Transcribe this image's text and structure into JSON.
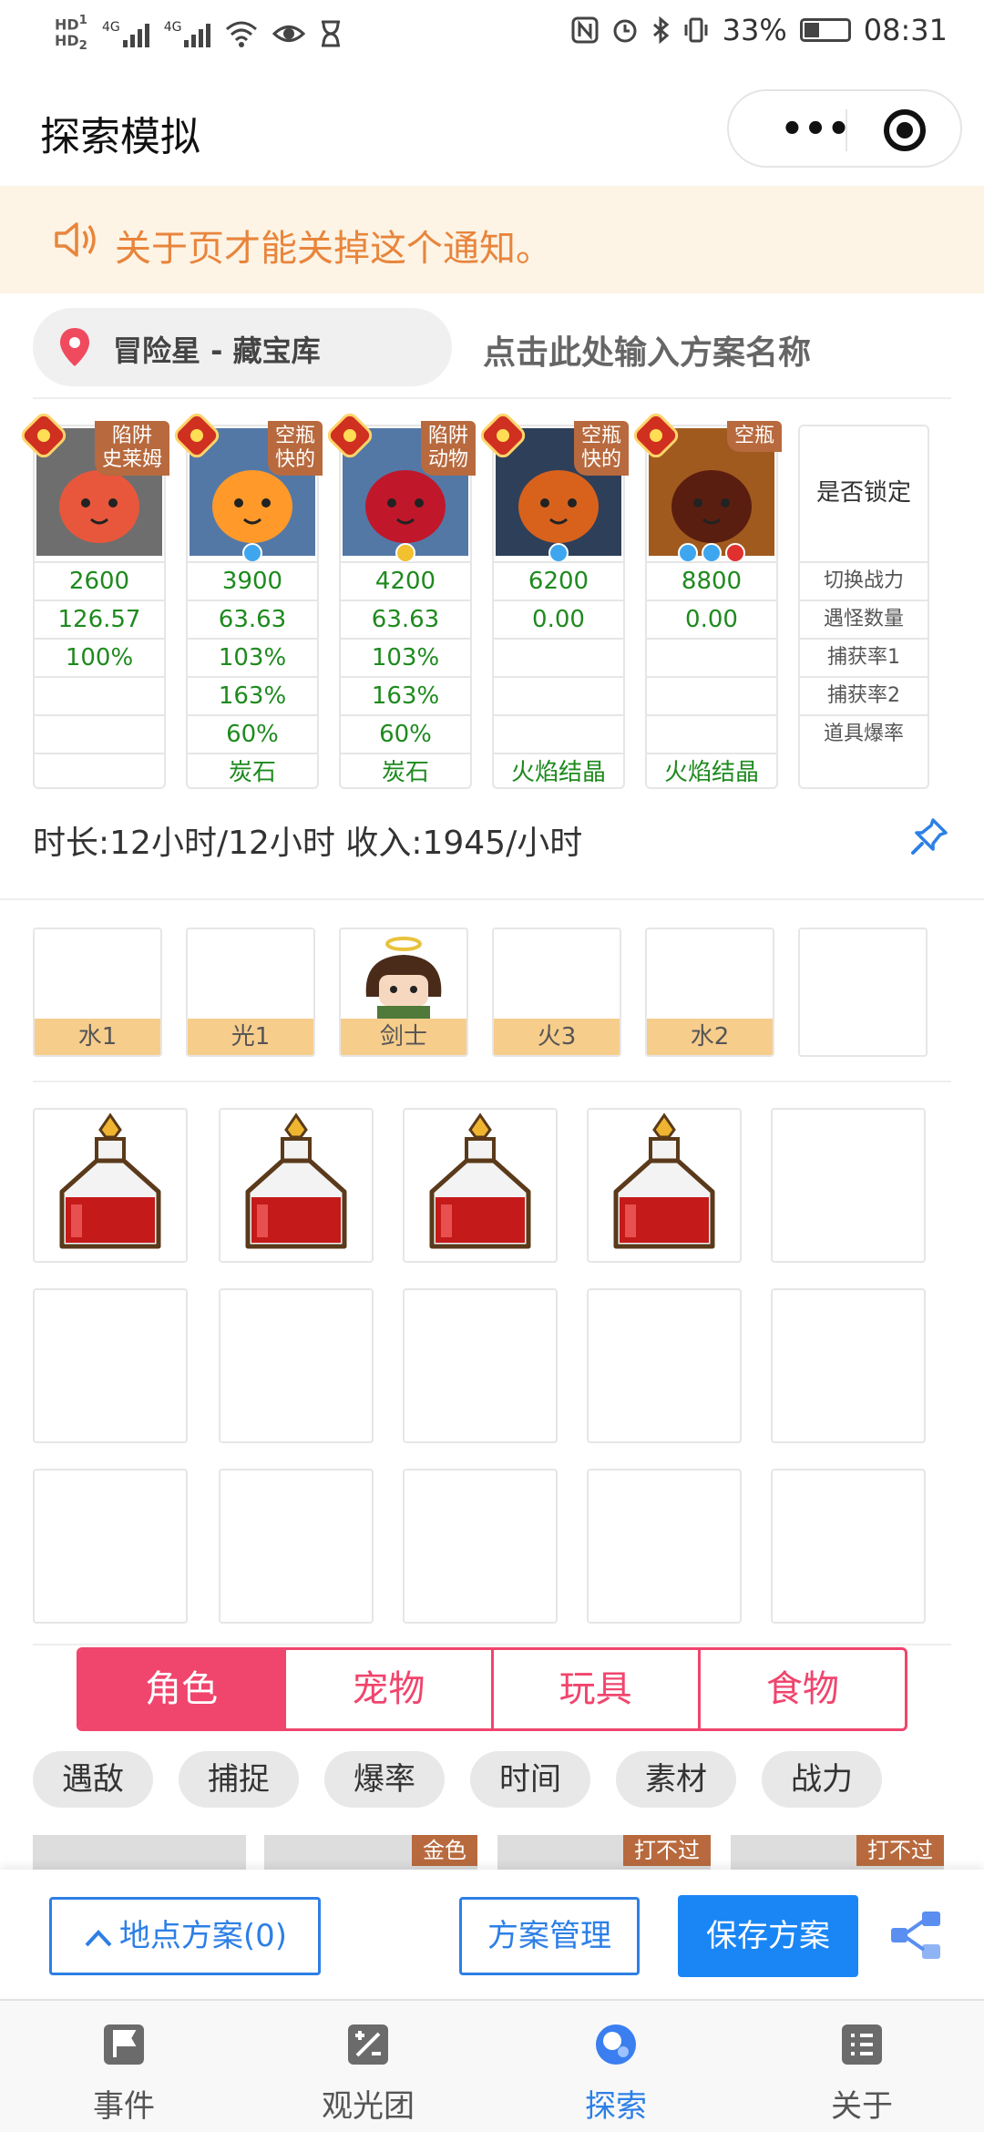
{
  "status_bar": {
    "network_left": "HD 1 / HD 2",
    "signal1": "4G",
    "signal2": "4G",
    "battery_percent": "33%",
    "time": "08:31"
  },
  "nav": {
    "title": "探索模拟",
    "menu_icon": "more-dots-icon",
    "close_icon": "target-icon"
  },
  "notice": {
    "text": "关于页才能关掉这个通知。"
  },
  "location": {
    "label": "冒险星 - 藏宝库",
    "plan_placeholder": "点击此处输入方案名称"
  },
  "monsters": [
    {
      "tag": "陷阱 史莱姆",
      "power": "2600",
      "encounters": "126.57",
      "cap1": "100%",
      "cap2": "",
      "drop": "",
      "item": "",
      "body": "#e8573c",
      "bg": "#6e6e6e"
    },
    {
      "tag": "空瓶 快的",
      "power": "3900",
      "encounters": "63.63",
      "cap1": "103%",
      "cap2": "163%",
      "drop": "60%",
      "item": "炭石",
      "body": "#ff9a2a",
      "bg": "#5478a6"
    },
    {
      "tag": "陷阱 动物",
      "power": "4200",
      "encounters": "63.63",
      "cap1": "103%",
      "cap2": "163%",
      "drop": "60%",
      "item": "炭石",
      "body": "#c0182a",
      "bg": "#5478a6"
    },
    {
      "tag": "空瓶 快的",
      "power": "6200",
      "encounters": "0.00",
      "cap1": "",
      "cap2": "",
      "drop": "",
      "item": "火焰结晶",
      "body": "#d8621c",
      "bg": "#2e3f59"
    },
    {
      "tag": "空瓶",
      "power": "8800",
      "encounters": "0.00",
      "cap1": "",
      "cap2": "",
      "drop": "",
      "item": "火焰结晶",
      "body": "#5a1e10",
      "bg": "#a05a1e"
    }
  ],
  "lock_column": {
    "header": "是否锁定",
    "rows": [
      "切换战力",
      "遇怪数量",
      "捕获率1",
      "捕获率2",
      "道具爆率"
    ]
  },
  "summary": {
    "text": "时长:12小时/12小时 收入:1945/小时"
  },
  "team": [
    {
      "label": "水1"
    },
    {
      "label": "光1"
    },
    {
      "label": "剑士"
    },
    {
      "label": "火3"
    },
    {
      "label": "水2"
    },
    {
      "label": ""
    }
  ],
  "tabs": [
    "角色",
    "宠物",
    "玩具",
    "食物"
  ],
  "active_tab": "角色",
  "filters": [
    "遇敌",
    "捕捉",
    "爆率",
    "时间",
    "素材",
    "战力"
  ],
  "card_badges": [
    "",
    "金色",
    "打不过",
    "打不过"
  ],
  "actions": {
    "location_plans": "地点方案(0)",
    "manage": "方案管理",
    "save": "保存方案"
  },
  "tabbar": [
    {
      "label": "事件",
      "icon": "flag-icon"
    },
    {
      "label": "观光团",
      "icon": "calc-icon"
    },
    {
      "label": "探索",
      "icon": "explore-icon"
    },
    {
      "label": "关于",
      "icon": "list-icon"
    }
  ],
  "colors": {
    "accent_pink": "#f0456d",
    "accent_blue": "#1a86f5",
    "value_green": "#1e8a1e",
    "notice_bg": "#fdf4e5",
    "notice_text": "#e8853c"
  }
}
